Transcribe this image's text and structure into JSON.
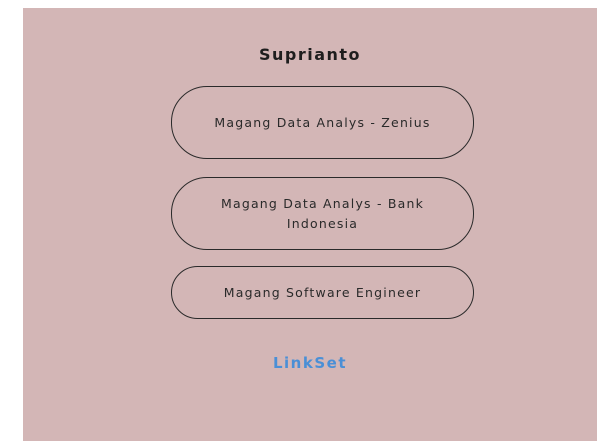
{
  "profile": {
    "name": "Suprianto"
  },
  "links": [
    {
      "label": "Magang Data Analys - Zenius"
    },
    {
      "label": "Magang Data Analys - Bank Indonesia"
    },
    {
      "label": "Magang Software Engineer"
    }
  ],
  "footer": {
    "brand": "LinkSet"
  },
  "colors": {
    "card_background": "#d3b6b6",
    "page_background": "#ffffff",
    "footer_brand": "#4a8fd6",
    "button_border": "#2a2a2a"
  }
}
